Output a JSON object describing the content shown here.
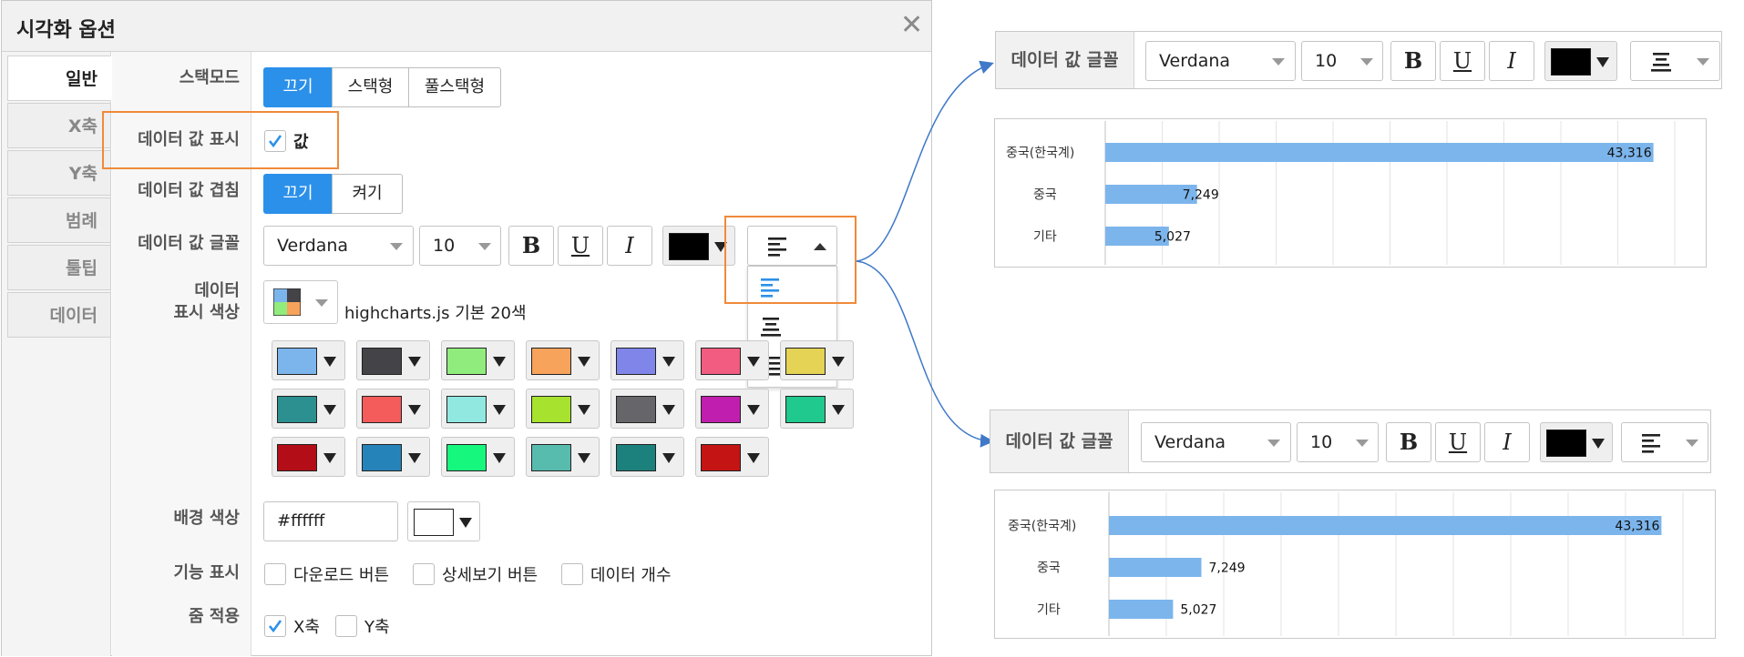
{
  "dialog": {
    "title": "시각화 옵션",
    "close_glyph": "✕"
  },
  "tabs": [
    "일반",
    "X축",
    "Y축",
    "범례",
    "툴팁",
    "데이터"
  ],
  "rows": {
    "stack_mode": {
      "label": "스택모드",
      "options": [
        "끄기",
        "스택형",
        "풀스택형"
      ],
      "selected": "끄기"
    },
    "show_value": {
      "label": "데이터 값 표시",
      "checkbox_label": "값",
      "checked": true
    },
    "overlap": {
      "label": "데이터 값 겹침",
      "options": [
        "끄기",
        "켜기"
      ],
      "selected": "끄기"
    },
    "font": {
      "label": "데이터 값 글꼴",
      "family": "Verdana",
      "size": "10",
      "bold": "B",
      "underline": "U",
      "italic": "I",
      "color": "#000000",
      "align_menu_open": true,
      "align_options": [
        "left-align-icon",
        "center-align-icon",
        "right-align-icon"
      ],
      "align_selected": "left-align-icon"
    },
    "data_colors": {
      "label_line1": "데이터",
      "label_line2": "표시 색상",
      "palette_name": "highcharts.js 기본 20색",
      "swatches": [
        "#7cb5ec",
        "#434348",
        "#90ed7d",
        "#f7a35c",
        "#8085e9",
        "#f15c80",
        "#e4d354",
        "#2b908f",
        "#f45b5b",
        "#91e8e1",
        "#a6e22e",
        "#66666a",
        "#c01eae",
        "#20c98d",
        "#b30e18",
        "#2683b9",
        "#16f77e",
        "#57bcae",
        "#1c817d",
        "#c41414"
      ]
    },
    "background": {
      "label": "배경 색상",
      "value": "#ffffff",
      "color": "#ffffff"
    },
    "features": {
      "label": "기능 표시",
      "items": [
        {
          "text": "다운로드 버튼",
          "checked": false
        },
        {
          "text": "상세보기 버튼",
          "checked": false
        },
        {
          "text": "데이터 개수",
          "checked": false
        }
      ]
    },
    "zoom": {
      "label": "줌 적용",
      "items": [
        {
          "text": "X축",
          "checked": true
        },
        {
          "text": "Y축",
          "checked": false
        }
      ]
    }
  },
  "preview_toolbar_top": {
    "label": "데이터 값 글꼴",
    "family": "Verdana",
    "size": "10",
    "bold": "B",
    "underline": "U",
    "italic": "I",
    "color": "#000000",
    "align": "center-align-icon"
  },
  "preview_toolbar_bottom": {
    "label": "데이터 값 글꼴",
    "family": "Verdana",
    "size": "10",
    "bold": "B",
    "underline": "U",
    "italic": "I",
    "color": "#000000",
    "align": "left-align-icon"
  },
  "accent": {
    "primary": "#2b90ea",
    "highlight": "#f08a3a",
    "bar": "#7cb5ec"
  },
  "chart_data": [
    {
      "type": "bar",
      "orientation": "horizontal",
      "categories": [
        "중국(한국계)",
        "중국",
        "기타"
      ],
      "values": [
        43316,
        7249,
        5027
      ],
      "data_labels": [
        "43,316",
        "7,249",
        "5,027"
      ],
      "label_align": "center",
      "xlim": [
        0,
        45000
      ],
      "grid": true
    },
    {
      "type": "bar",
      "orientation": "horizontal",
      "categories": [
        "중국(한국계)",
        "중국",
        "기타"
      ],
      "values": [
        43316,
        7249,
        5027
      ],
      "data_labels": [
        "43,316",
        "7,249",
        "5,027"
      ],
      "label_align": "left",
      "xlim": [
        0,
        45000
      ],
      "grid": true
    }
  ]
}
